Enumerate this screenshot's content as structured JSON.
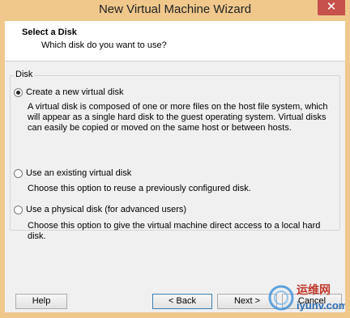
{
  "window": {
    "title": "New Virtual Machine Wizard",
    "close_glyph": "✕"
  },
  "header": {
    "title": "Select a Disk",
    "subtitle": "Which disk do you want to use?"
  },
  "disk_group": {
    "label": "Disk",
    "options": [
      {
        "label": "Create a new virtual disk",
        "selected": true,
        "description": "A virtual disk is composed of one or more files on the host file system, which will appear as a single hard disk to the guest operating system. Virtual disks can easily be copied or moved on the same host or between hosts."
      },
      {
        "label": "Use an existing virtual disk",
        "selected": false,
        "description": "Choose this option to reuse a previously configured disk."
      },
      {
        "label": "Use a physical disk (for advanced users)",
        "selected": false,
        "description": "Choose this option to give the virtual machine direct access to a local hard disk."
      }
    ]
  },
  "buttons": {
    "help": "Help",
    "back": "< Back",
    "next": "Next >",
    "cancel": "Cancel"
  },
  "watermark": {
    "line1": "运维网",
    "line2": "iyunv.com"
  }
}
